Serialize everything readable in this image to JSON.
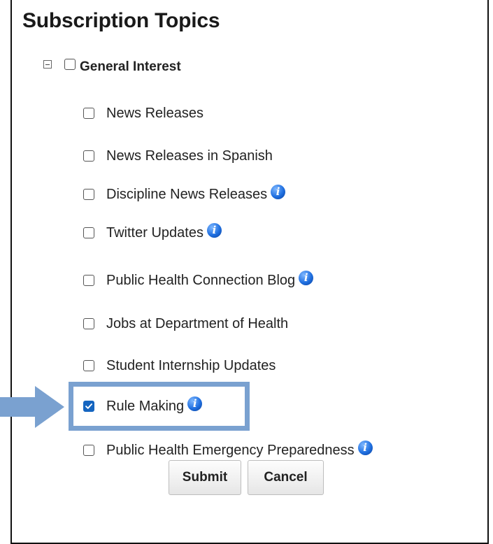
{
  "title": "Subscription Topics",
  "group": {
    "label": "General Interest",
    "checked": false,
    "expanded": true
  },
  "topics": [
    {
      "label": "News Releases",
      "checked": false,
      "info": false
    },
    {
      "label": "News Releases in Spanish",
      "checked": false,
      "info": false
    },
    {
      "label": "Discipline News Releases",
      "checked": false,
      "info": true
    },
    {
      "label": "Twitter Updates",
      "checked": false,
      "info": true
    },
    {
      "label": "Public Health Connection Blog",
      "checked": false,
      "info": true
    },
    {
      "label": "Jobs at Department of Health",
      "checked": false,
      "info": false
    },
    {
      "label": "Student Internship Updates",
      "checked": false,
      "info": false
    },
    {
      "label": "Rule Making",
      "checked": true,
      "info": true
    },
    {
      "label": "Public Health Emergency Preparedness",
      "checked": false,
      "info": true
    }
  ],
  "buttons": {
    "submit": "Submit",
    "cancel": "Cancel"
  },
  "icons": {
    "info": "info-icon",
    "info_glyph": "i",
    "collapse": "minus-box-icon",
    "arrow": "arrow-right-icon"
  },
  "colors": {
    "highlight": "#7aa1d0",
    "checkbox_checked": "#1565c0",
    "info_icon": "#1f6fe0"
  }
}
